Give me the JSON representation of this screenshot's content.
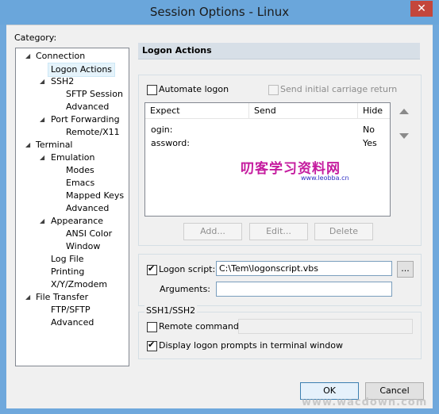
{
  "window": {
    "title": "Session Options - Linux",
    "close_glyph": "✕"
  },
  "category_label": "Category:",
  "tree": {
    "connection": "Connection",
    "logon_actions": "Logon Actions",
    "ssh2": "SSH2",
    "sftp_session": "SFTP Session",
    "advanced1": "Advanced",
    "port_forwarding": "Port Forwarding",
    "remote_x11": "Remote/X11",
    "terminal": "Terminal",
    "emulation": "Emulation",
    "modes": "Modes",
    "emacs": "Emacs",
    "mapped_keys": "Mapped Keys",
    "advanced2": "Advanced",
    "appearance": "Appearance",
    "ansi_color": "ANSI Color",
    "window": "Window",
    "log_file": "Log File",
    "printing": "Printing",
    "xyz_modem": "X/Y/Zmodem",
    "file_transfer": "File Transfer",
    "ftp_sftp": "FTP/SFTP",
    "advanced3": "Advanced"
  },
  "panel_title": "Logon Actions",
  "automate_logon": {
    "label": "Automate logon",
    "checked": false
  },
  "send_cr": {
    "label": "Send initial carriage return",
    "checked": false,
    "enabled": false
  },
  "table": {
    "headers": [
      "Expect",
      "Send",
      "Hide"
    ],
    "rows": [
      {
        "expect": "ogin:",
        "send": "",
        "hide": "No"
      },
      {
        "expect": "assword:",
        "send": "",
        "hide": "Yes"
      }
    ]
  },
  "buttons": {
    "add": "Add...",
    "edit": "Edit...",
    "delete": "Delete",
    "browse": "...",
    "ok": "OK",
    "cancel": "Cancel"
  },
  "logon_script": {
    "label": "Logon script:",
    "checked": true,
    "value": "C:\\Tem\\logonscript.vbs"
  },
  "arguments": {
    "label": "Arguments:",
    "value": ""
  },
  "ssh_group": {
    "title": "SSH1/SSH2"
  },
  "remote_command": {
    "label": "Remote command:",
    "checked": false,
    "value": ""
  },
  "display_prompts": {
    "label": "Display logon prompts in terminal window",
    "checked": true
  },
  "watermark": {
    "main": "叨客学习资料网",
    "url": "www.leobba.cn",
    "bottom": "www.wacdown.com"
  },
  "colors": {
    "title_bar": "#6aa6db",
    "close": "#c4463b",
    "header_bar": "#d7dfe7",
    "watermark": "#c51c9f"
  }
}
